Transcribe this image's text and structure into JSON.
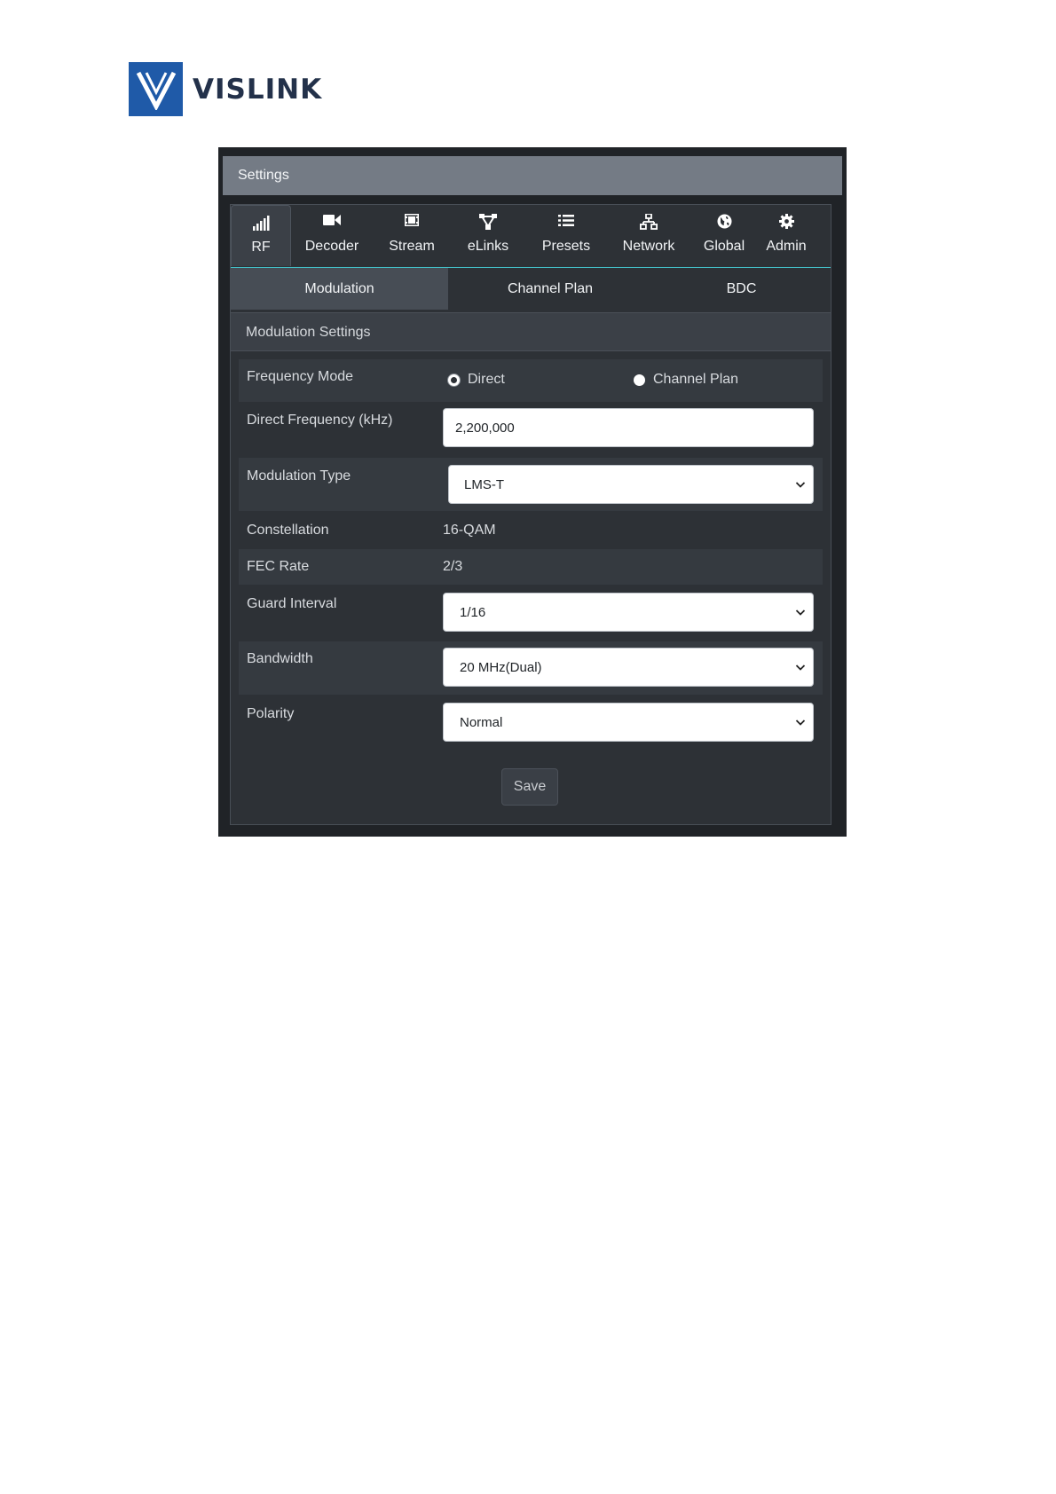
{
  "brand": {
    "name": "VISLINK",
    "colors": {
      "logo_blue": "#1f5aa8",
      "wordmark": "#23314a"
    }
  },
  "window": {
    "title": "Settings"
  },
  "nav": {
    "items": [
      {
        "label": "RF",
        "icon": "signal-bars-icon",
        "active": true
      },
      {
        "label": "Decoder",
        "icon": "video-camera-icon"
      },
      {
        "label": "Stream",
        "icon": "film-icon"
      },
      {
        "label": "eLinks",
        "icon": "sitemap-icon"
      },
      {
        "label": "Presets",
        "icon": "list-icon"
      },
      {
        "label": "Network",
        "icon": "network-icon"
      },
      {
        "label": "Global",
        "icon": "globe-icon"
      },
      {
        "label": "Admin",
        "icon": "gear-icon"
      }
    ],
    "accent": "#43c0c8"
  },
  "subtabs": [
    {
      "label": "Modulation",
      "active": true
    },
    {
      "label": "Channel Plan"
    },
    {
      "label": "BDC"
    }
  ],
  "section": {
    "title": "Modulation Settings"
  },
  "form": {
    "frequency_mode": {
      "label": "Frequency Mode",
      "options": [
        {
          "label": "Direct",
          "selected": true
        },
        {
          "label": "Channel Plan",
          "selected": false
        }
      ]
    },
    "direct_frequency": {
      "label": "Direct Frequency (kHz)",
      "value": "2,200,000"
    },
    "modulation_type": {
      "label": "Modulation Type",
      "value": "LMS-T"
    },
    "constellation": {
      "label": "Constellation",
      "value": "16-QAM"
    },
    "fec_rate": {
      "label": "FEC Rate",
      "value": "2/3"
    },
    "guard_interval": {
      "label": "Guard Interval",
      "value": "1/16"
    },
    "bandwidth": {
      "label": "Bandwidth",
      "value": "20 MHz(Dual)"
    },
    "polarity": {
      "label": "Polarity",
      "value": "Normal"
    },
    "save_label": "Save"
  }
}
